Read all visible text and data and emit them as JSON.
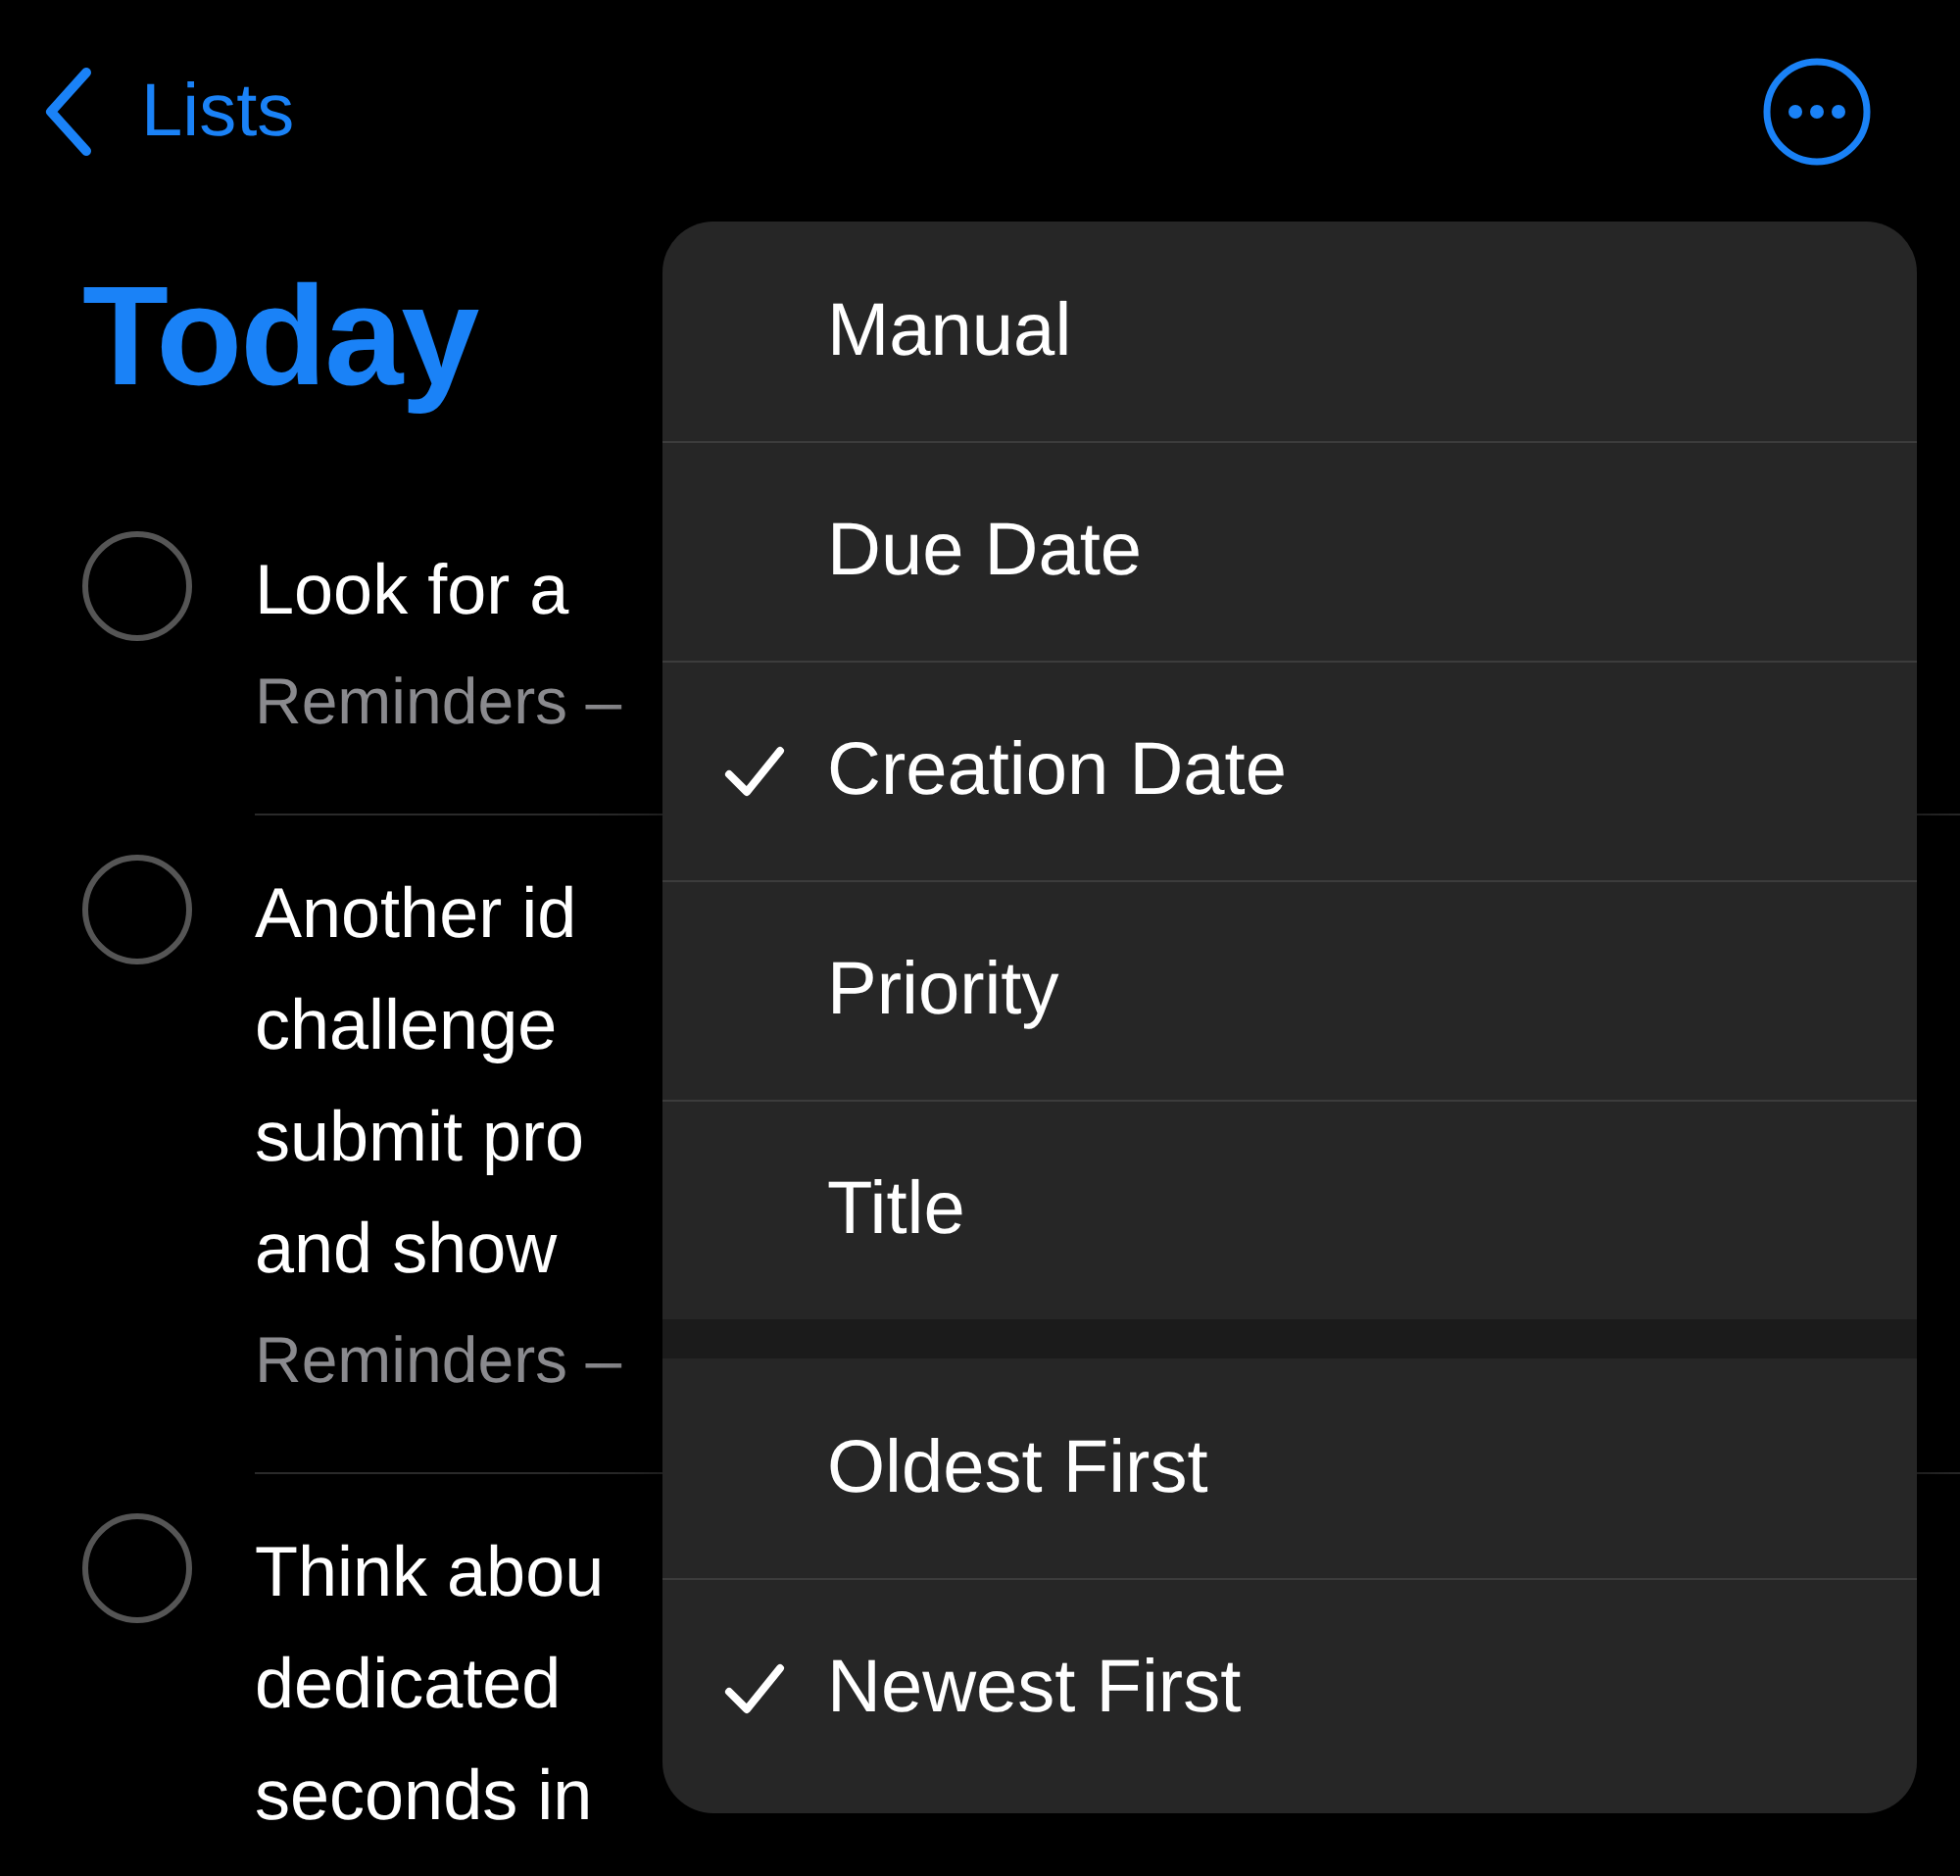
{
  "nav": {
    "back_label": "Lists"
  },
  "title": "Today",
  "tasks": [
    {
      "lines": [
        "Look for a"
      ],
      "subtitle": "Reminders –"
    },
    {
      "lines": [
        "Another id",
        "challenge",
        "submit pro",
        "and show"
      ],
      "subtitle": "Reminders –"
    },
    {
      "lines": [
        "Think abou",
        "dedicated",
        "seconds in"
      ]
    }
  ],
  "sort_menu": {
    "sections": [
      {
        "items": [
          {
            "label": "Manual",
            "selected": false
          },
          {
            "label": "Due Date",
            "selected": false
          },
          {
            "label": "Creation Date",
            "selected": true
          },
          {
            "label": "Priority",
            "selected": false
          },
          {
            "label": "Title",
            "selected": false
          }
        ]
      },
      {
        "items": [
          {
            "label": "Oldest First",
            "selected": false
          },
          {
            "label": "Newest First",
            "selected": true
          }
        ]
      }
    ]
  }
}
